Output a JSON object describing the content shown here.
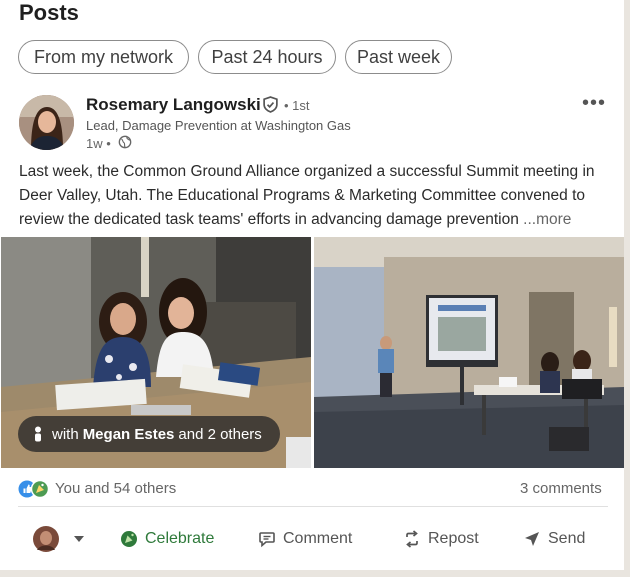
{
  "page": {
    "title": "Posts"
  },
  "filters": [
    {
      "label": "From my network"
    },
    {
      "label": "Past 24 hours"
    },
    {
      "label": "Past week"
    }
  ],
  "post": {
    "author": {
      "name": "Rosemary Langowski",
      "degree": "• 1st",
      "headline": "Lead, Damage Prevention at Washington Gas",
      "time": "1w •"
    },
    "text": "Last week, the Common Ground Alliance organized a successful Summit meeting in Deer Valley, Utah. The Educational Programs & Marketing Committee convened to review the dedicated task teams' efforts in advancing damage prevention",
    "see_more": "...more",
    "tag": {
      "prefix": "with",
      "name": "Megan Estes",
      "suffix": "and 2 others"
    },
    "reactions_text": "You and 54 others",
    "comments_text": "3 comments"
  },
  "actions": {
    "celebrate": "Celebrate",
    "comment": "Comment",
    "repost": "Repost",
    "send": "Send"
  },
  "colors": {
    "celebrate_green": "#2f7a3b",
    "like_blue": "#378fe9"
  },
  "icons": [
    "verified-shield-icon",
    "globe-icon",
    "more-dots-icon",
    "person-icon",
    "like-reaction-icon",
    "celebrate-reaction-icon",
    "celebrate-icon",
    "comment-icon",
    "repost-icon",
    "send-icon",
    "chevron-down-icon"
  ]
}
